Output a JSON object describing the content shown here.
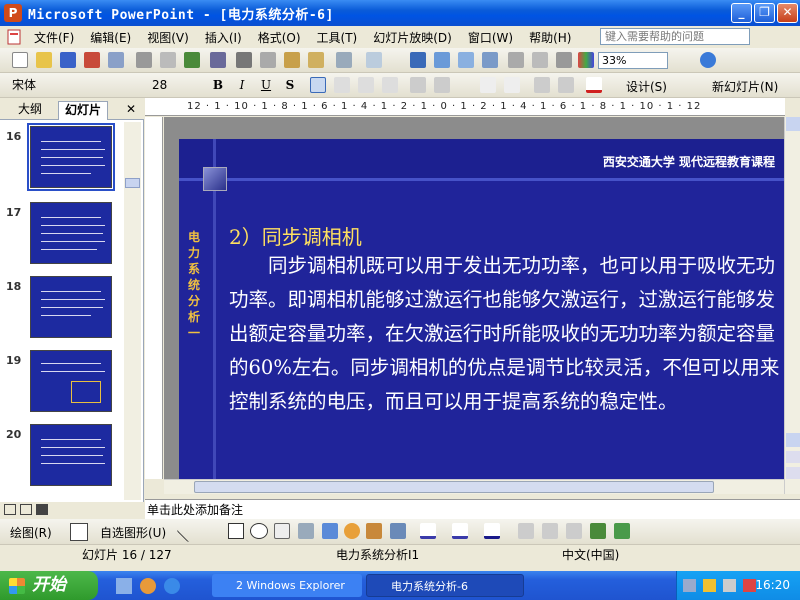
{
  "window": {
    "icon_text": "P",
    "title": "Microsoft PowerPoint - [电力系统分析-6]",
    "minimize": "_",
    "restore": "❐",
    "close": "✕"
  },
  "menu": {
    "items": [
      "文件(F)",
      "编辑(E)",
      "视图(V)",
      "插入(I)",
      "格式(O)",
      "工具(T)",
      "幻灯片放映(D)",
      "窗口(W)",
      "帮助(H)"
    ],
    "help_placeholder": "键入需要帮助的问题"
  },
  "format_toolbar": {
    "font": "宋体",
    "font_size": "28",
    "bold": "B",
    "italic": "I",
    "underline": "U",
    "shadow": "S",
    "design": "设计(S)",
    "new_slide": "新幻灯片(N)"
  },
  "standard_toolbar": {
    "zoom": "33%"
  },
  "left_pane": {
    "tabs": [
      "大纲",
      "幻灯片"
    ],
    "active_tab": "幻灯片",
    "slide_numbers": [
      "16",
      "17",
      "18",
      "19",
      "20"
    ],
    "selected": "16"
  },
  "ruler": {
    "horizontal": "12 · 1 · 10 · 1 · 8 · 1 · 6 · 1 · 4 · 1 · 2 · 1 · 0 · 1 · 2 · 1 · 4 · 1 · 6 · 1 · 8 · 1 · 10 · 1 · 12"
  },
  "slide": {
    "header_text": "西安交通大学  现代远程教育课程",
    "sidebar_title": "电力系统分析一",
    "heading": "2）同步调相机",
    "body": "同步调相机既可以用于发出无功功率，也可以用于吸收无功功率。即调相机能够过激运行也能够欠激运行，过激运行能够发出额定容量功率，在欠激运行时所能吸收的无功功率为额定容量的60%左右。同步调相机的优点是调节比较灵活，不但可以用来控制系统的电压，而且可以用于提高系统的稳定性。"
  },
  "notes": {
    "placeholder": "单击此处添加备注"
  },
  "draw_toolbar": {
    "draw": "绘图(R)",
    "autoshapes": "自选图形(U)"
  },
  "status": {
    "slide": "幻灯片 16 / 127",
    "design": "电力系统分析I1",
    "language": "中文(中国)"
  },
  "taskbar": {
    "start": "开始",
    "explorer": "2 Windows Explorer",
    "ppt": "电力系统分析-6",
    "clock": "16:20"
  }
}
